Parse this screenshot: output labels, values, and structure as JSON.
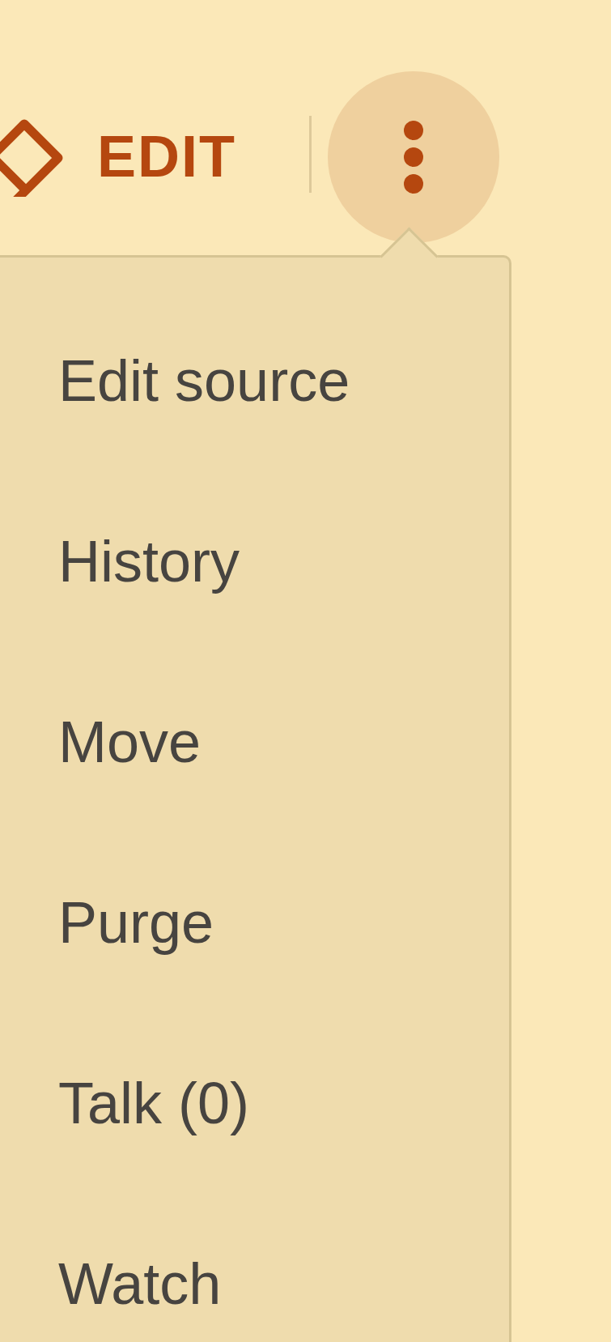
{
  "toolbar": {
    "edit_button": {
      "label": "EDIT"
    }
  },
  "more_menu": {
    "expanded": true,
    "items": [
      {
        "label": "Edit source"
      },
      {
        "label": "History"
      },
      {
        "label": "Move"
      },
      {
        "label": "Purge"
      },
      {
        "label": "Talk (0)"
      },
      {
        "label": "Watch"
      }
    ]
  }
}
